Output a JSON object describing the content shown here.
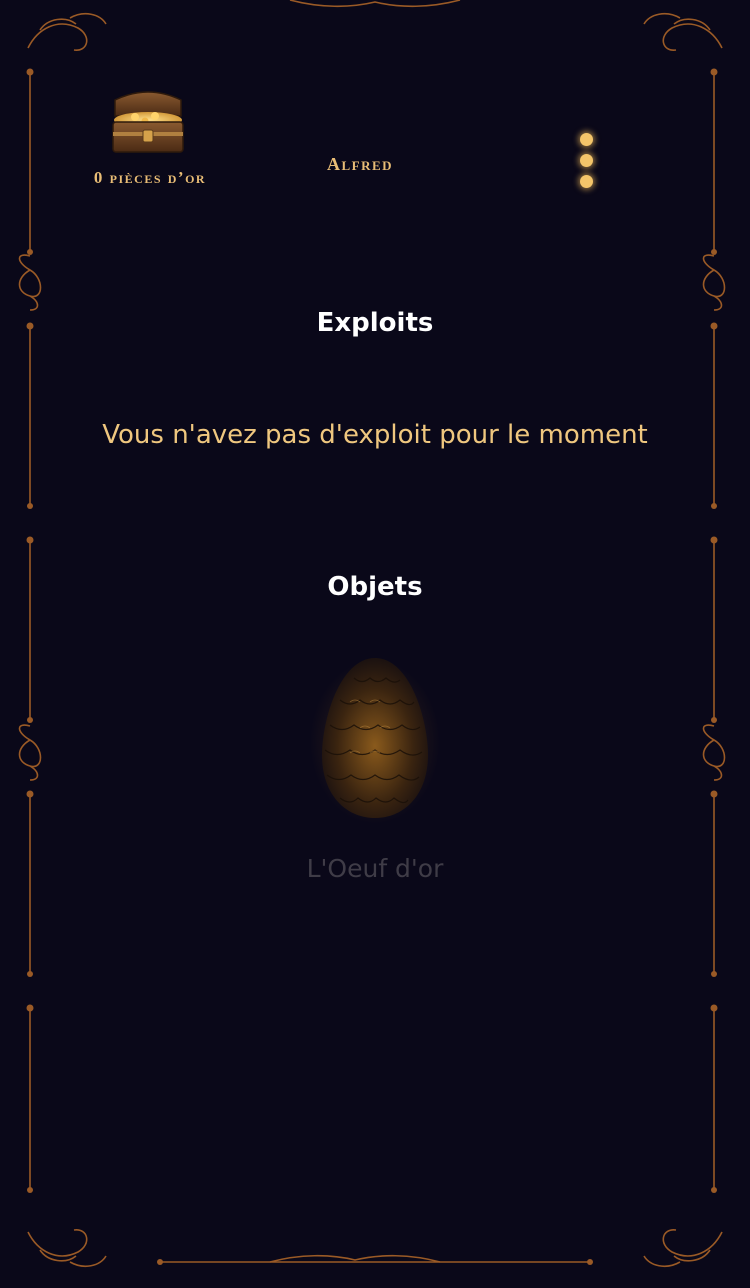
{
  "header": {
    "gold_label": "0 pièces d’or",
    "player_name": "Alfred"
  },
  "exploits": {
    "title": "Exploits",
    "empty_message": "Vous n'avez pas d'exploit pour le moment"
  },
  "objets": {
    "title": "Objets",
    "items": [
      {
        "name": "L'Oeuf d'or",
        "icon": "golden-egg-icon"
      }
    ]
  },
  "icons": {
    "chest": "treasure-chest-icon",
    "menu": "more-vertical-icon"
  },
  "colors": {
    "background": "#0a0819",
    "accent_gold": "#e9bd76",
    "ornament": "#9a5a26",
    "title": "#ffffff",
    "muted_item": "#3f3c47"
  }
}
